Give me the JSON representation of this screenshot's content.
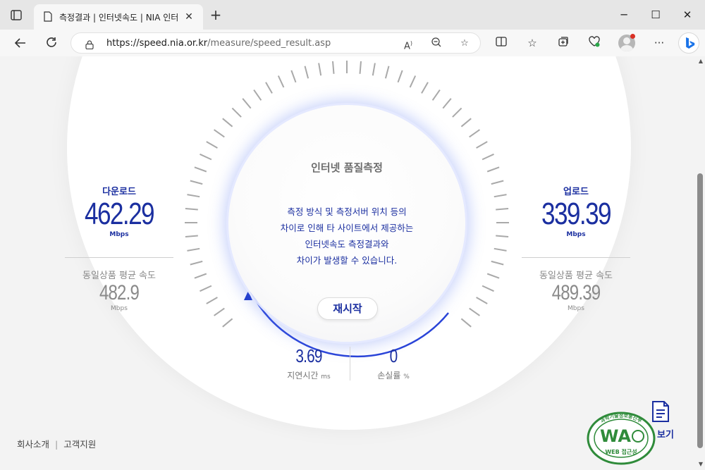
{
  "browser": {
    "tab_title": "측정결과 | 인터넷속도 | NIA 인터",
    "url_host": "https://speed.nia.or.kr",
    "url_path": "/measure/speed_result.asp",
    "icons": [
      "tab-actions-icon",
      "page-icon",
      "close-icon",
      "plus-icon",
      "minimize-icon",
      "maximize-icon",
      "close-window-icon",
      "back-icon",
      "refresh-icon",
      "lock-icon",
      "read-aloud-icon",
      "zoom-icon",
      "star-icon",
      "split-screen-icon",
      "favorites-icon",
      "collections-icon",
      "heart-pulse-icon",
      "profile-icon",
      "more-icon",
      "bing-icon"
    ]
  },
  "center": {
    "title": "인터넷 품질측정",
    "notice_lines": [
      "측정 방식 및 측정서버 위치 등의",
      "차이로 인해 타 사이트에서 제공하는",
      "인터넷속도 측정결과와",
      "차이가 발생할 수 있습니다."
    ],
    "restart_label": "재시작"
  },
  "download": {
    "title": "다운로드",
    "value": "462.29",
    "unit": "Mbps",
    "avg_title": "동일상품 평균 속도",
    "avg_value": "482.9",
    "avg_unit": "Mbps"
  },
  "upload": {
    "title": "업로드",
    "value": "339.39",
    "unit": "Mbps",
    "avg_title": "동일상품 평균 속도",
    "avg_value": "489.39",
    "avg_unit": "Mbps"
  },
  "latency": {
    "value": "3.69",
    "label": "지연시간",
    "unit": "ms"
  },
  "loss": {
    "value": "0",
    "label": "손실률",
    "unit": "%"
  },
  "footer": {
    "company": "회사소개",
    "support": "고객지원",
    "separator": "|"
  },
  "report": {
    "label": "보기"
  },
  "badge": {
    "text": "WA",
    "sub": "WEB 접근성",
    "ring": "과학기술정보통신부"
  },
  "colors": {
    "accent": "#1b2fa0",
    "gauge_arc": "#2a44d8",
    "badge_green": "#2f8b3a"
  }
}
